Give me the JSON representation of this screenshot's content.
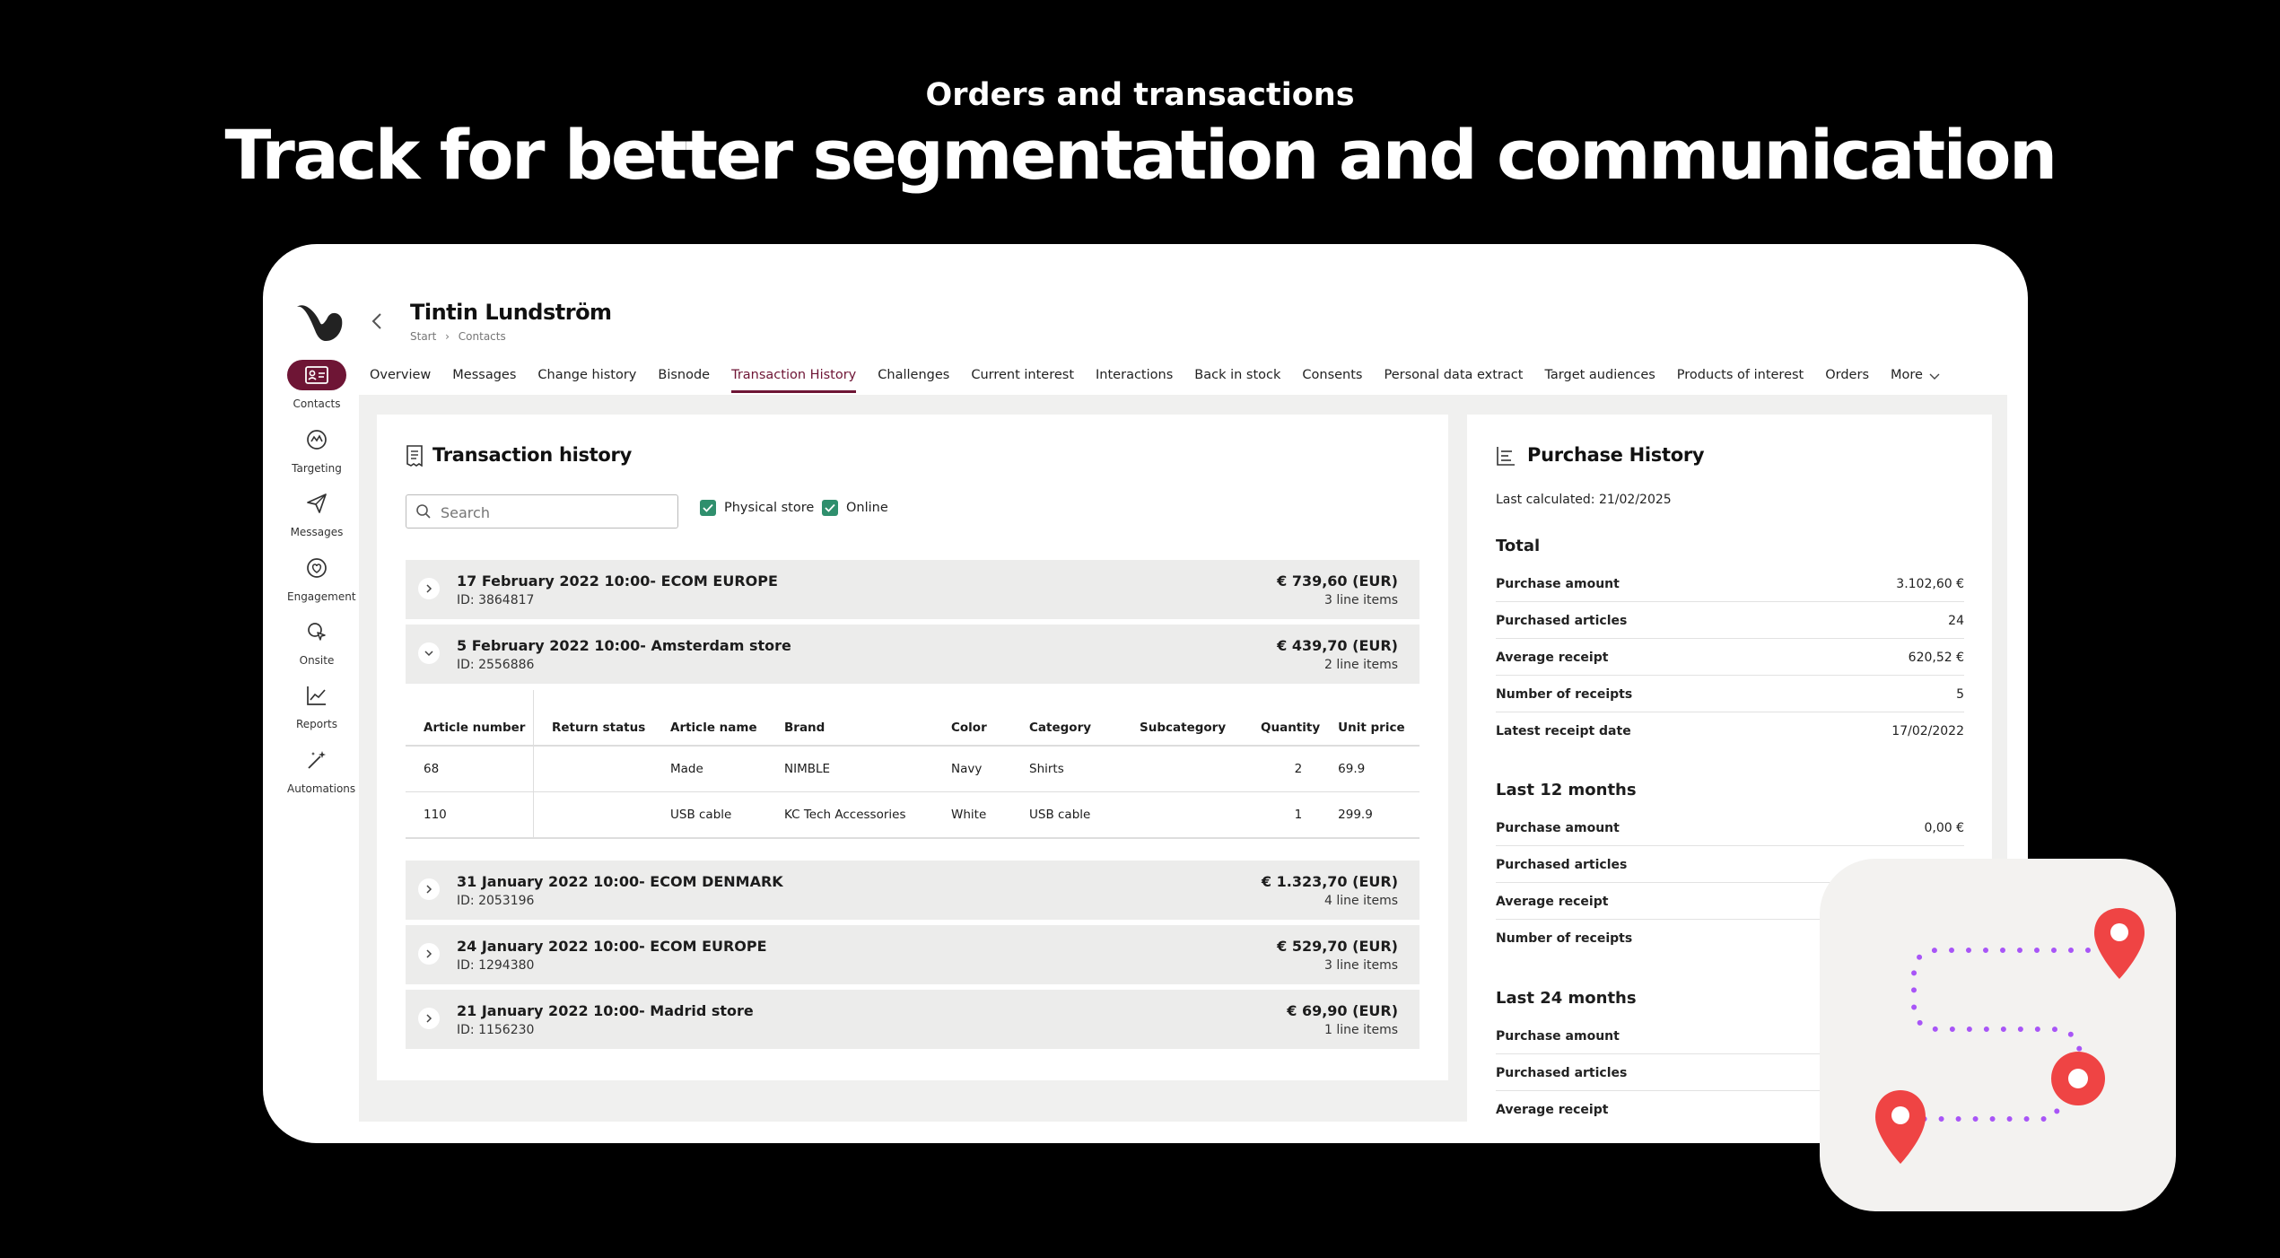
{
  "hero": {
    "subtitle": "Orders and transactions",
    "title": "Track for better segmentation and communication"
  },
  "colors": {
    "accent": "#6e1535",
    "check": "#2f8f6d",
    "route": "#a855f7",
    "pin": "#ef4444"
  },
  "sidebar": {
    "items": [
      {
        "label": "Contacts",
        "icon": "contacts-icon",
        "active": true
      },
      {
        "label": "Targeting",
        "icon": "targeting-icon"
      },
      {
        "label": "Messages",
        "icon": "messages-icon"
      },
      {
        "label": "Engagement",
        "icon": "engagement-icon"
      },
      {
        "label": "Onsite",
        "icon": "onsite-icon"
      },
      {
        "label": "Reports",
        "icon": "reports-icon"
      },
      {
        "label": "Automations",
        "icon": "automations-icon"
      }
    ]
  },
  "header": {
    "name": "Tintin Lundström",
    "breadcrumb": [
      "Start",
      "Contacts"
    ]
  },
  "tabs": [
    "Overview",
    "Messages",
    "Change history",
    "Bisnode",
    "Transaction History",
    "Challenges",
    "Current interest",
    "Interactions",
    "Back in stock",
    "Consents",
    "Personal data extract",
    "Target audiences",
    "Products of interest",
    "Orders",
    "More"
  ],
  "active_tab": "Transaction History",
  "transactions": {
    "title": "Transaction history",
    "search_placeholder": "Search",
    "filters": [
      "Physical store",
      "Online"
    ],
    "rows": [
      {
        "title": "17 February 2022 10:00- ECOM EUROPE",
        "id": "ID: 3864817",
        "amount": "€ 739,60 (EUR)",
        "lines": "3 line items",
        "expanded": false
      },
      {
        "title": "5 February 2022 10:00- Amsterdam store",
        "id": "ID: 2556886",
        "amount": "€ 439,70 (EUR)",
        "lines": "2 line items",
        "expanded": true
      },
      {
        "title": "31 January 2022 10:00- ECOM DENMARK",
        "id": "ID: 2053196",
        "amount": "€ 1.323,70 (EUR)",
        "lines": "4 line items",
        "expanded": false
      },
      {
        "title": "24 January 2022 10:00- ECOM EUROPE",
        "id": "ID: 1294380",
        "amount": "€ 529,70 (EUR)",
        "lines": "3 line items",
        "expanded": false
      },
      {
        "title": "21 January 2022 10:00- Madrid store",
        "id": "ID: 1156230",
        "amount": "€ 69,90 (EUR)",
        "lines": "1 line items",
        "expanded": false
      }
    ],
    "items_table": {
      "headers": [
        "Article number",
        "Return status",
        "Article name",
        "Brand",
        "Color",
        "Category",
        "Subcategory",
        "Quantity",
        "Unit price"
      ],
      "rows": [
        [
          "68",
          "",
          "Made",
          "NIMBLE",
          "Navy",
          "Shirts",
          "",
          "2",
          "69.9"
        ],
        [
          "110",
          "",
          "USB cable",
          "KC Tech Accessories",
          "White",
          "USB cable",
          "",
          "1",
          "299.9"
        ]
      ]
    }
  },
  "purchase_history": {
    "title": "Purchase History",
    "last_calculated": "Last calculated: 21/02/2025",
    "sections": [
      {
        "heading": "Total",
        "rows": [
          {
            "k": "Purchase amount",
            "v": "3.102,60 €"
          },
          {
            "k": "Purchased articles",
            "v": "24"
          },
          {
            "k": "Average receipt",
            "v": "620,52 €"
          },
          {
            "k": "Number of receipts",
            "v": "5"
          },
          {
            "k": "Latest receipt date",
            "v": "17/02/2022"
          }
        ]
      },
      {
        "heading": "Last 12 months",
        "rows": [
          {
            "k": "Purchase amount",
            "v": "0,00 €"
          },
          {
            "k": "Purchased articles",
            "v": ""
          },
          {
            "k": "Average receipt",
            "v": ""
          },
          {
            "k": "Number of receipts",
            "v": ""
          }
        ]
      },
      {
        "heading": "Last 24 months",
        "rows": [
          {
            "k": "Purchase amount",
            "v": ""
          },
          {
            "k": "Purchased articles",
            "v": ""
          },
          {
            "k": "Average receipt",
            "v": ""
          }
        ]
      }
    ]
  }
}
